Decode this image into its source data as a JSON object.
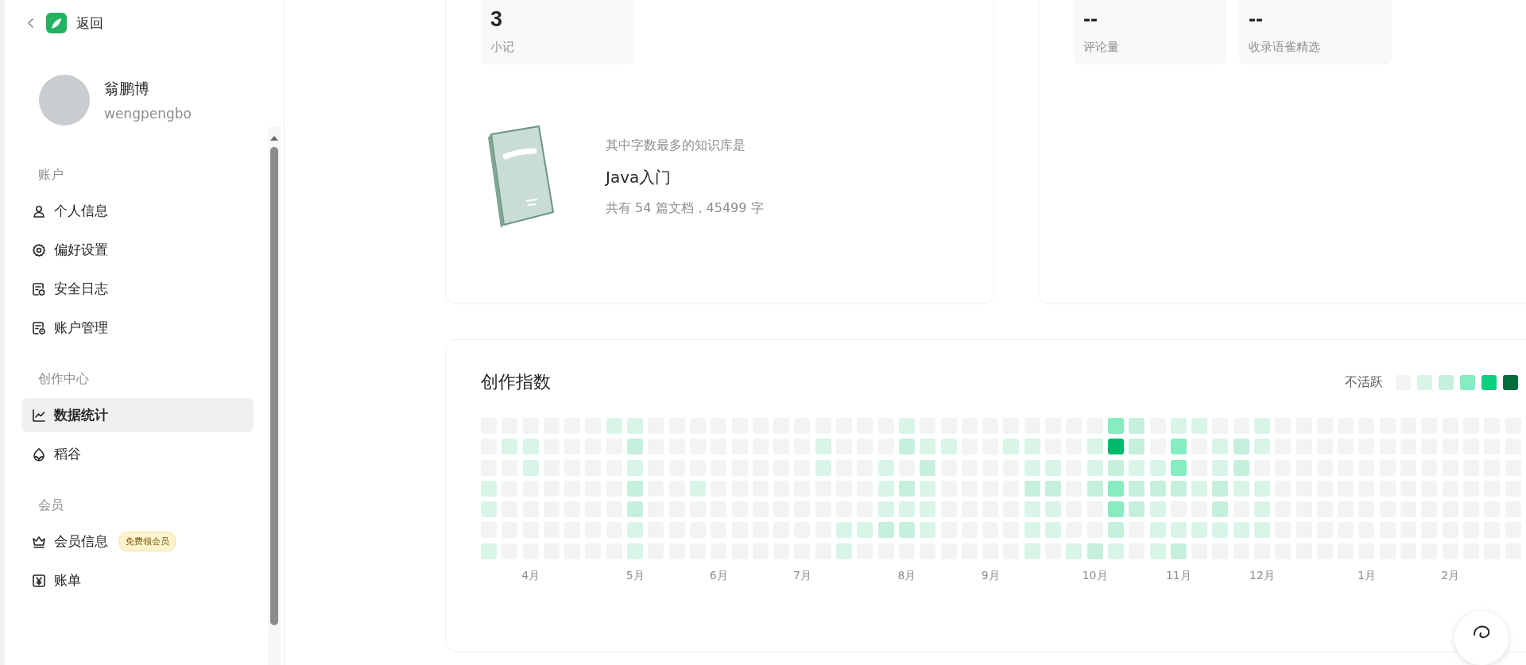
{
  "sidebar": {
    "back": {
      "label": "返回"
    },
    "profile": {
      "name": "翁鹏博",
      "username": "wengpengbo"
    },
    "sections": [
      {
        "title": "账户",
        "items": [
          {
            "label": "个人信息",
            "selected": false
          },
          {
            "label": "偏好设置",
            "selected": false
          },
          {
            "label": "安全日志",
            "selected": false
          },
          {
            "label": "账户管理",
            "selected": false
          }
        ]
      },
      {
        "title": "创作中心",
        "items": [
          {
            "label": "数据统计",
            "selected": true
          },
          {
            "label": "稻谷",
            "selected": false
          }
        ]
      },
      {
        "title": "会员",
        "items": [
          {
            "label": "会员信息",
            "selected": false,
            "badge": "免费领会员"
          },
          {
            "label": "账单",
            "selected": false
          }
        ]
      }
    ]
  },
  "summary_card": {
    "tiles": [
      {
        "value": "3",
        "label": "小记"
      }
    ],
    "top_book": {
      "caption": "其中字数最多的知识库是",
      "title": "Java入门",
      "details": "共有 54 篇文档，45499 字"
    }
  },
  "interaction_card": {
    "tiles": [
      {
        "value": "--",
        "label": "评论量"
      },
      {
        "value": "--",
        "label": "收录语雀精选"
      }
    ]
  },
  "heatmap": {
    "title": "创作指数",
    "legend": {
      "label": "不活跃",
      "swatches": [
        {
          "color": "#f2f4f3"
        },
        {
          "color": "#d8f5e8"
        },
        {
          "color": "#c6efdc"
        },
        {
          "color": "#86ecc2"
        },
        {
          "color": "#0bd07f"
        },
        {
          "color": "#006b3c"
        }
      ]
    },
    "weeks": [
      {
        "cells": [
          {
            "color": "#f2f4f3"
          },
          {
            "color": "#f2f4f3"
          },
          {
            "color": "#f2f4f3"
          },
          {
            "color": "#d8f5e8"
          },
          {
            "color": "#d8f5e8"
          },
          {
            "color": "#f2f4f3"
          },
          {
            "color": "#d8f5e8"
          }
        ]
      },
      {
        "cells": [
          {
            "color": "#f2f4f3"
          },
          {
            "color": "#d8f5e8"
          },
          {
            "color": "#f2f4f3"
          },
          {
            "color": "#f2f4f3"
          },
          {
            "color": "#f2f4f3"
          },
          {
            "color": "#f2f4f3"
          },
          {
            "color": "#f2f4f3"
          }
        ]
      },
      {
        "month": "4月",
        "cells": [
          {
            "color": "#f2f4f3"
          },
          {
            "color": "#d8f5e8"
          },
          {
            "color": "#d8f5e8"
          },
          {
            "color": "#f2f4f3"
          },
          {
            "color": "#f2f4f3"
          },
          {
            "color": "#f2f4f3"
          },
          {
            "color": "#f2f4f3"
          }
        ]
      },
      {
        "cells": [
          {
            "color": "#f2f4f3"
          },
          {
            "color": "#f2f4f3"
          },
          {
            "color": "#f2f4f3"
          },
          {
            "color": "#f2f4f3"
          },
          {
            "color": "#f2f4f3"
          },
          {
            "color": "#f2f4f3"
          },
          {
            "color": "#f2f4f3"
          }
        ]
      },
      {
        "cells": [
          {
            "color": "#f2f4f3"
          },
          {
            "color": "#f2f4f3"
          },
          {
            "color": "#f2f4f3"
          },
          {
            "color": "#f2f4f3"
          },
          {
            "color": "#f2f4f3"
          },
          {
            "color": "#f2f4f3"
          },
          {
            "color": "#f2f4f3"
          }
        ]
      },
      {
        "cells": [
          {
            "color": "#f2f4f3"
          },
          {
            "color": "#f2f4f3"
          },
          {
            "color": "#f2f4f3"
          },
          {
            "color": "#f2f4f3"
          },
          {
            "color": "#f2f4f3"
          },
          {
            "color": "#f2f4f3"
          },
          {
            "color": "#f2f4f3"
          }
        ]
      },
      {
        "cells": [
          {
            "color": "#d8f5e8"
          },
          {
            "color": "#f2f4f3"
          },
          {
            "color": "#f2f4f3"
          },
          {
            "color": "#f2f4f3"
          },
          {
            "color": "#f2f4f3"
          },
          {
            "color": "#f2f4f3"
          },
          {
            "color": "#f2f4f3"
          }
        ]
      },
      {
        "month": "5月",
        "cells": [
          {
            "color": "#d8f5e8"
          },
          {
            "color": "#c6efdc"
          },
          {
            "color": "#d8f5e8"
          },
          {
            "color": "#c6efdc"
          },
          {
            "color": "#c6efdc"
          },
          {
            "color": "#d8f5e8"
          },
          {
            "color": "#d8f5e8"
          }
        ]
      },
      {
        "cells": [
          {
            "color": "#f2f4f3"
          },
          {
            "color": "#f2f4f3"
          },
          {
            "color": "#f2f4f3"
          },
          {
            "color": "#f2f4f3"
          },
          {
            "color": "#f2f4f3"
          },
          {
            "color": "#f2f4f3"
          },
          {
            "color": "#f2f4f3"
          }
        ]
      },
      {
        "cells": [
          {
            "color": "#f2f4f3"
          },
          {
            "color": "#f2f4f3"
          },
          {
            "color": "#f2f4f3"
          },
          {
            "color": "#f2f4f3"
          },
          {
            "color": "#f2f4f3"
          },
          {
            "color": "#f2f4f3"
          },
          {
            "color": "#f2f4f3"
          }
        ]
      },
      {
        "cells": [
          {
            "color": "#f2f4f3"
          },
          {
            "color": "#f2f4f3"
          },
          {
            "color": "#f2f4f3"
          },
          {
            "color": "#d8f5e8"
          },
          {
            "color": "#f2f4f3"
          },
          {
            "color": "#f2f4f3"
          },
          {
            "color": "#f2f4f3"
          }
        ]
      },
      {
        "month": "6月",
        "cells": [
          {
            "color": "#f2f4f3"
          },
          {
            "color": "#f2f4f3"
          },
          {
            "color": "#f2f4f3"
          },
          {
            "color": "#f2f4f3"
          },
          {
            "color": "#f2f4f3"
          },
          {
            "color": "#f2f4f3"
          },
          {
            "color": "#f2f4f3"
          }
        ]
      },
      {
        "cells": [
          {
            "color": "#f2f4f3"
          },
          {
            "color": "#f2f4f3"
          },
          {
            "color": "#f2f4f3"
          },
          {
            "color": "#f2f4f3"
          },
          {
            "color": "#f2f4f3"
          },
          {
            "color": "#f2f4f3"
          },
          {
            "color": "#f2f4f3"
          }
        ]
      },
      {
        "cells": [
          {
            "color": "#f2f4f3"
          },
          {
            "color": "#f2f4f3"
          },
          {
            "color": "#f2f4f3"
          },
          {
            "color": "#f2f4f3"
          },
          {
            "color": "#f2f4f3"
          },
          {
            "color": "#f2f4f3"
          },
          {
            "color": "#f2f4f3"
          }
        ]
      },
      {
        "cells": [
          {
            "color": "#f2f4f3"
          },
          {
            "color": "#f2f4f3"
          },
          {
            "color": "#f2f4f3"
          },
          {
            "color": "#f2f4f3"
          },
          {
            "color": "#f2f4f3"
          },
          {
            "color": "#f2f4f3"
          },
          {
            "color": "#f2f4f3"
          }
        ]
      },
      {
        "month": "7月",
        "cells": [
          {
            "color": "#f2f4f3"
          },
          {
            "color": "#f2f4f3"
          },
          {
            "color": "#f2f4f3"
          },
          {
            "color": "#f2f4f3"
          },
          {
            "color": "#f2f4f3"
          },
          {
            "color": "#f2f4f3"
          },
          {
            "color": "#f2f4f3"
          }
        ]
      },
      {
        "cells": [
          {
            "color": "#f2f4f3"
          },
          {
            "color": "#d8f5e8"
          },
          {
            "color": "#d8f5e8"
          },
          {
            "color": "#f2f4f3"
          },
          {
            "color": "#f2f4f3"
          },
          {
            "color": "#f2f4f3"
          },
          {
            "color": "#f2f4f3"
          }
        ]
      },
      {
        "cells": [
          {
            "color": "#f2f4f3"
          },
          {
            "color": "#f2f4f3"
          },
          {
            "color": "#f2f4f3"
          },
          {
            "color": "#f2f4f3"
          },
          {
            "color": "#f2f4f3"
          },
          {
            "color": "#d8f5e8"
          },
          {
            "color": "#d8f5e8"
          }
        ]
      },
      {
        "cells": [
          {
            "color": "#f2f4f3"
          },
          {
            "color": "#f2f4f3"
          },
          {
            "color": "#f2f4f3"
          },
          {
            "color": "#f2f4f3"
          },
          {
            "color": "#f2f4f3"
          },
          {
            "color": "#d8f5e8"
          },
          {
            "color": "#f2f4f3"
          }
        ]
      },
      {
        "cells": [
          {
            "color": "#f2f4f3"
          },
          {
            "color": "#f2f4f3"
          },
          {
            "color": "#d8f5e8"
          },
          {
            "color": "#d8f5e8"
          },
          {
            "color": "#d8f5e8"
          },
          {
            "color": "#c6efdc"
          },
          {
            "color": "#f2f4f3"
          }
        ]
      },
      {
        "month": "8月",
        "cells": [
          {
            "color": "#d8f5e8"
          },
          {
            "color": "#c6efdc"
          },
          {
            "color": "#f2f4f3"
          },
          {
            "color": "#c6efdc"
          },
          {
            "color": "#d8f5e8"
          },
          {
            "color": "#c6efdc"
          },
          {
            "color": "#f2f4f3"
          }
        ]
      },
      {
        "cells": [
          {
            "color": "#f2f4f3"
          },
          {
            "color": "#d8f5e8"
          },
          {
            "color": "#c6efdc"
          },
          {
            "color": "#d8f5e8"
          },
          {
            "color": "#d8f5e8"
          },
          {
            "color": "#d8f5e8"
          },
          {
            "color": "#f2f4f3"
          }
        ]
      },
      {
        "cells": [
          {
            "color": "#f2f4f3"
          },
          {
            "color": "#d8f5e8"
          },
          {
            "color": "#f2f4f3"
          },
          {
            "color": "#f2f4f3"
          },
          {
            "color": "#f2f4f3"
          },
          {
            "color": "#f2f4f3"
          },
          {
            "color": "#f2f4f3"
          }
        ]
      },
      {
        "cells": [
          {
            "color": "#f2f4f3"
          },
          {
            "color": "#f2f4f3"
          },
          {
            "color": "#f2f4f3"
          },
          {
            "color": "#f2f4f3"
          },
          {
            "color": "#f2f4f3"
          },
          {
            "color": "#f2f4f3"
          },
          {
            "color": "#f2f4f3"
          }
        ]
      },
      {
        "month": "9月",
        "cells": [
          {
            "color": "#f2f4f3"
          },
          {
            "color": "#f2f4f3"
          },
          {
            "color": "#f2f4f3"
          },
          {
            "color": "#f2f4f3"
          },
          {
            "color": "#f2f4f3"
          },
          {
            "color": "#f2f4f3"
          },
          {
            "color": "#f2f4f3"
          }
        ]
      },
      {
        "cells": [
          {
            "color": "#f2f4f3"
          },
          {
            "color": "#d8f5e8"
          },
          {
            "color": "#f2f4f3"
          },
          {
            "color": "#f2f4f3"
          },
          {
            "color": "#f2f4f3"
          },
          {
            "color": "#f2f4f3"
          },
          {
            "color": "#f2f4f3"
          }
        ]
      },
      {
        "cells": [
          {
            "color": "#f2f4f3"
          },
          {
            "color": "#d8f5e8"
          },
          {
            "color": "#d8f5e8"
          },
          {
            "color": "#c6efdc"
          },
          {
            "color": "#d8f5e8"
          },
          {
            "color": "#d8f5e8"
          },
          {
            "color": "#d8f5e8"
          }
        ]
      },
      {
        "cells": [
          {
            "color": "#f2f4f3"
          },
          {
            "color": "#f2f4f3"
          },
          {
            "color": "#d8f5e8"
          },
          {
            "color": "#c6efdc"
          },
          {
            "color": "#d8f5e8"
          },
          {
            "color": "#d8f5e8"
          },
          {
            "color": "#f2f4f3"
          }
        ]
      },
      {
        "cells": [
          {
            "color": "#f2f4f3"
          },
          {
            "color": "#f2f4f3"
          },
          {
            "color": "#f2f4f3"
          },
          {
            "color": "#f2f4f3"
          },
          {
            "color": "#f2f4f3"
          },
          {
            "color": "#f2f4f3"
          },
          {
            "color": "#d8f5e8"
          }
        ]
      },
      {
        "month": "10月",
        "cells": [
          {
            "color": "#f2f4f3"
          },
          {
            "color": "#d8f5e8"
          },
          {
            "color": "#d8f5e8"
          },
          {
            "color": "#c6efdc"
          },
          {
            "color": "#f2f4f3"
          },
          {
            "color": "#f2f4f3"
          },
          {
            "color": "#c6efdc"
          }
        ]
      },
      {
        "cells": [
          {
            "color": "#86ecc2"
          },
          {
            "color": "#00b96b"
          },
          {
            "color": "#c6efdc"
          },
          {
            "color": "#86ecc2"
          },
          {
            "color": "#86ecc2"
          },
          {
            "color": "#c6efdc"
          },
          {
            "color": "#d8f5e8"
          }
        ]
      },
      {
        "cells": [
          {
            "color": "#c6efdc"
          },
          {
            "color": "#c6efdc"
          },
          {
            "color": "#d8f5e8"
          },
          {
            "color": "#c6efdc"
          },
          {
            "color": "#c6efdc"
          },
          {
            "color": "#f2f4f3"
          },
          {
            "color": "#f2f4f3"
          }
        ]
      },
      {
        "cells": [
          {
            "color": "#f2f4f3"
          },
          {
            "color": "#f2f4f3"
          },
          {
            "color": "#d8f5e8"
          },
          {
            "color": "#c6efdc"
          },
          {
            "color": "#d8f5e8"
          },
          {
            "color": "#d8f5e8"
          },
          {
            "color": "#d8f5e8"
          }
        ]
      },
      {
        "month": "11月",
        "cells": [
          {
            "color": "#d8f5e8"
          },
          {
            "color": "#86ecc2"
          },
          {
            "color": "#86ecc2"
          },
          {
            "color": "#c6efdc"
          },
          {
            "color": "#f2f4f3"
          },
          {
            "color": "#d8f5e8"
          },
          {
            "color": "#c6efdc"
          }
        ]
      },
      {
        "cells": [
          {
            "color": "#d8f5e8"
          },
          {
            "color": "#f2f4f3"
          },
          {
            "color": "#f2f4f3"
          },
          {
            "color": "#d8f5e8"
          },
          {
            "color": "#f2f4f3"
          },
          {
            "color": "#d8f5e8"
          },
          {
            "color": "#f2f4f3"
          }
        ]
      },
      {
        "cells": [
          {
            "color": "#f2f4f3"
          },
          {
            "color": "#d8f5e8"
          },
          {
            "color": "#d8f5e8"
          },
          {
            "color": "#c6efdc"
          },
          {
            "color": "#c6efdc"
          },
          {
            "color": "#d8f5e8"
          },
          {
            "color": "#f2f4f3"
          }
        ]
      },
      {
        "cells": [
          {
            "color": "#f2f4f3"
          },
          {
            "color": "#c6efdc"
          },
          {
            "color": "#c6efdc"
          },
          {
            "color": "#d8f5e8"
          },
          {
            "color": "#f2f4f3"
          },
          {
            "color": "#d8f5e8"
          },
          {
            "color": "#f2f4f3"
          }
        ]
      },
      {
        "month": "12月",
        "cells": [
          {
            "color": "#d8f5e8"
          },
          {
            "color": "#d8f5e8"
          },
          {
            "color": "#f2f4f3"
          },
          {
            "color": "#d8f5e8"
          },
          {
            "color": "#d8f5e8"
          },
          {
            "color": "#d8f5e8"
          },
          {
            "color": "#f2f4f3"
          }
        ]
      },
      {
        "cells": [
          {
            "color": "#f2f4f3"
          },
          {
            "color": "#f2f4f3"
          },
          {
            "color": "#f2f4f3"
          },
          {
            "color": "#f2f4f3"
          },
          {
            "color": "#f2f4f3"
          },
          {
            "color": "#f2f4f3"
          },
          {
            "color": "#f2f4f3"
          }
        ]
      },
      {
        "cells": [
          {
            "color": "#f2f4f3"
          },
          {
            "color": "#f2f4f3"
          },
          {
            "color": "#f2f4f3"
          },
          {
            "color": "#f2f4f3"
          },
          {
            "color": "#f2f4f3"
          },
          {
            "color": "#f2f4f3"
          },
          {
            "color": "#f2f4f3"
          }
        ]
      },
      {
        "cells": [
          {
            "color": "#f2f4f3"
          },
          {
            "color": "#f2f4f3"
          },
          {
            "color": "#f2f4f3"
          },
          {
            "color": "#f2f4f3"
          },
          {
            "color": "#f2f4f3"
          },
          {
            "color": "#f2f4f3"
          },
          {
            "color": "#f2f4f3"
          }
        ]
      },
      {
        "cells": [
          {
            "color": "#f2f4f3"
          },
          {
            "color": "#f2f4f3"
          },
          {
            "color": "#f2f4f3"
          },
          {
            "color": "#f2f4f3"
          },
          {
            "color": "#f2f4f3"
          },
          {
            "color": "#f2f4f3"
          },
          {
            "color": "#f2f4f3"
          }
        ]
      },
      {
        "month": "1月",
        "cells": [
          {
            "color": "#f2f4f3"
          },
          {
            "color": "#f2f4f3"
          },
          {
            "color": "#f2f4f3"
          },
          {
            "color": "#f2f4f3"
          },
          {
            "color": "#f2f4f3"
          },
          {
            "color": "#f2f4f3"
          },
          {
            "color": "#f2f4f3"
          }
        ]
      },
      {
        "cells": [
          {
            "color": "#f2f4f3"
          },
          {
            "color": "#f2f4f3"
          },
          {
            "color": "#f2f4f3"
          },
          {
            "color": "#f2f4f3"
          },
          {
            "color": "#f2f4f3"
          },
          {
            "color": "#f2f4f3"
          },
          {
            "color": "#f2f4f3"
          }
        ]
      },
      {
        "cells": [
          {
            "color": "#f2f4f3"
          },
          {
            "color": "#f2f4f3"
          },
          {
            "color": "#f2f4f3"
          },
          {
            "color": "#f2f4f3"
          },
          {
            "color": "#f2f4f3"
          },
          {
            "color": "#f2f4f3"
          },
          {
            "color": "#f2f4f3"
          }
        ]
      },
      {
        "cells": [
          {
            "color": "#f2f4f3"
          },
          {
            "color": "#f2f4f3"
          },
          {
            "color": "#f2f4f3"
          },
          {
            "color": "#f2f4f3"
          },
          {
            "color": "#f2f4f3"
          },
          {
            "color": "#f2f4f3"
          },
          {
            "color": "#f2f4f3"
          }
        ]
      },
      {
        "month": "2月",
        "cells": [
          {
            "color": "#f2f4f3"
          },
          {
            "color": "#f2f4f3"
          },
          {
            "color": "#f2f4f3"
          },
          {
            "color": "#f2f4f3"
          },
          {
            "color": "#f2f4f3"
          },
          {
            "color": "#f2f4f3"
          },
          {
            "color": "#f2f4f3"
          }
        ]
      },
      {
        "cells": [
          {
            "color": "#f2f4f3"
          },
          {
            "color": "#f2f4f3"
          },
          {
            "color": "#f2f4f3"
          },
          {
            "color": "#f2f4f3"
          },
          {
            "color": "#f2f4f3"
          },
          {
            "color": "#f2f4f3"
          },
          {
            "color": "#f2f4f3"
          }
        ]
      },
      {
        "cells": [
          {
            "color": "#f2f4f3"
          },
          {
            "color": "#f2f4f3"
          },
          {
            "color": "#f2f4f3"
          },
          {
            "color": "#f2f4f3"
          },
          {
            "color": "#f2f4f3"
          },
          {
            "color": "#f2f4f3"
          },
          {
            "color": "#f2f4f3"
          }
        ]
      },
      {
        "cells": [
          {
            "color": "#f2f4f3"
          },
          {
            "color": "#f2f4f3"
          },
          {
            "color": "#f2f4f3"
          },
          {
            "color": "#f2f4f3"
          },
          {
            "color": "#f2f4f3"
          },
          {
            "color": "#f2f4f3"
          },
          {
            "color": "#f2f4f3"
          }
        ]
      }
    ]
  }
}
